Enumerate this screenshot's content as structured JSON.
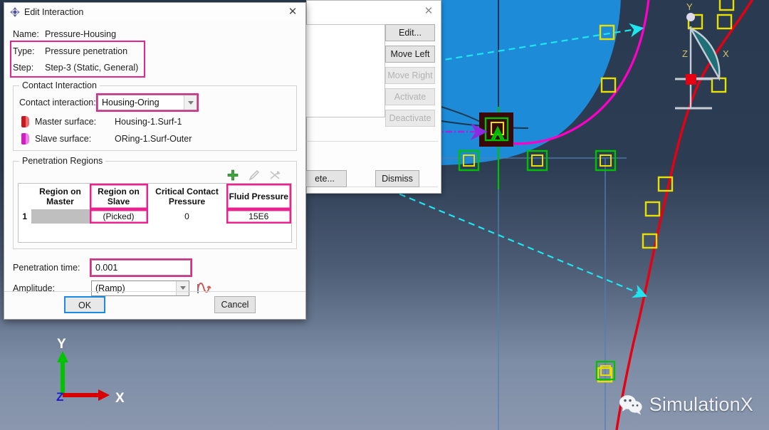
{
  "app": {
    "watermark": "SimulationX",
    "watermark_icon": "wechat-icon"
  },
  "viewport": {
    "triad": {
      "x_label": "X",
      "y_label": "Y",
      "z_label": "Z"
    },
    "csys_widget": {
      "x_label": "X",
      "y_label": "Y",
      "z_label": "Z"
    },
    "colors": {
      "background_top": "#2a3a50",
      "background_bottom": "#8a97ae",
      "part_blue": "#1e8bd8",
      "oring_magenta": "#ff00c8",
      "path_red": "#e50012",
      "node_yellow": "#e8e000",
      "select_green": "#00c000",
      "highlight_cyan": "#1ee6f0",
      "arrow_purple": "#8a2be2"
    }
  },
  "bg_dialog": {
    "close_icon": "close-icon",
    "buttons": [
      {
        "label": "Edit...",
        "enabled": true
      },
      {
        "label": "Move Left",
        "enabled": true
      },
      {
        "label": "Move Right",
        "enabled": false
      },
      {
        "label": "Activate",
        "enabled": false
      },
      {
        "label": "Deactivate",
        "enabled": false
      }
    ],
    "footer": {
      "delete_label": "ete...",
      "dismiss_label": "Dismiss"
    }
  },
  "dialog": {
    "icon": "interaction-icon",
    "title": "Edit Interaction",
    "close_icon": "close-icon",
    "fields": {
      "name_label": "Name:",
      "name_value": "Pressure-Housing",
      "type_label": "Type:",
      "type_value": "Pressure penetration",
      "step_label": "Step:",
      "step_value": "Step-3 (Static, General)"
    },
    "contact_interaction": {
      "group_label": "Contact Interaction",
      "combo_label": "Contact interaction:",
      "combo_value": "Housing-Oring",
      "master_label": "Master surface:",
      "master_value": "Housing-1.Surf-1",
      "slave_label": "Slave surface:",
      "slave_value": "ORing-1.Surf-Outer"
    },
    "penetration_regions": {
      "group_label": "Penetration Regions",
      "toolbar": [
        {
          "name": "add-icon",
          "enabled": true
        },
        {
          "name": "edit-icon",
          "enabled": false
        },
        {
          "name": "delete-icon",
          "enabled": false
        }
      ],
      "columns": [
        "Region on Master",
        "Region on Slave",
        "Critical Contact Pressure",
        "Fluid Pressure"
      ],
      "rows": [
        {
          "index": "1",
          "region_on_master": "",
          "region_on_slave": "(Picked)",
          "critical_contact_pressure": "0",
          "fluid_pressure": "15E6"
        }
      ]
    },
    "penetration_time_label": "Penetration time:",
    "penetration_time_value": "0.001",
    "amplitude_label": "Amplitude:",
    "amplitude_value": "(Ramp)",
    "amplitude_icon": "amplitude-curve-icon",
    "ok_label": "OK",
    "cancel_label": "Cancel"
  }
}
